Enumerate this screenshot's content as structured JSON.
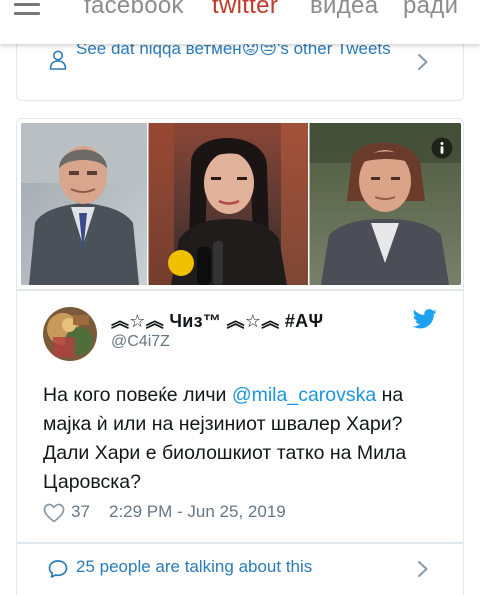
{
  "nav": {
    "tabs": [
      {
        "label": "facebook",
        "active": false
      },
      {
        "label": "twitter",
        "active": true
      },
      {
        "label": "видеа",
        "active": false
      },
      {
        "label": "ради",
        "active": false
      }
    ],
    "active_color": "#c0392b"
  },
  "see_more": {
    "label": "See dat niqqa ветмен😟😒's other Tweets",
    "link_color": "#2b7bb9",
    "icon": "person-icon"
  },
  "tweet": {
    "media_icon": "info-icon",
    "author_name": "︽☆︽ Чиз™ ︽☆︽ #АΨ",
    "author_handle": "@C4i7Z",
    "text_before": "На кого повеќе личи ",
    "mention": "@mila_carovska",
    "text_after": " на мајка ѝ или на нејзиниот швалер Хари? Дали Хари е биолошкиот татко на Мила Царовска?",
    "likes": "37",
    "timestamp": "2:29 PM - Jun 25, 2019",
    "brand_color": "#1da1f2"
  },
  "conversation": {
    "label": "25 people are talking about this",
    "icon": "chat-bubble-icon"
  }
}
